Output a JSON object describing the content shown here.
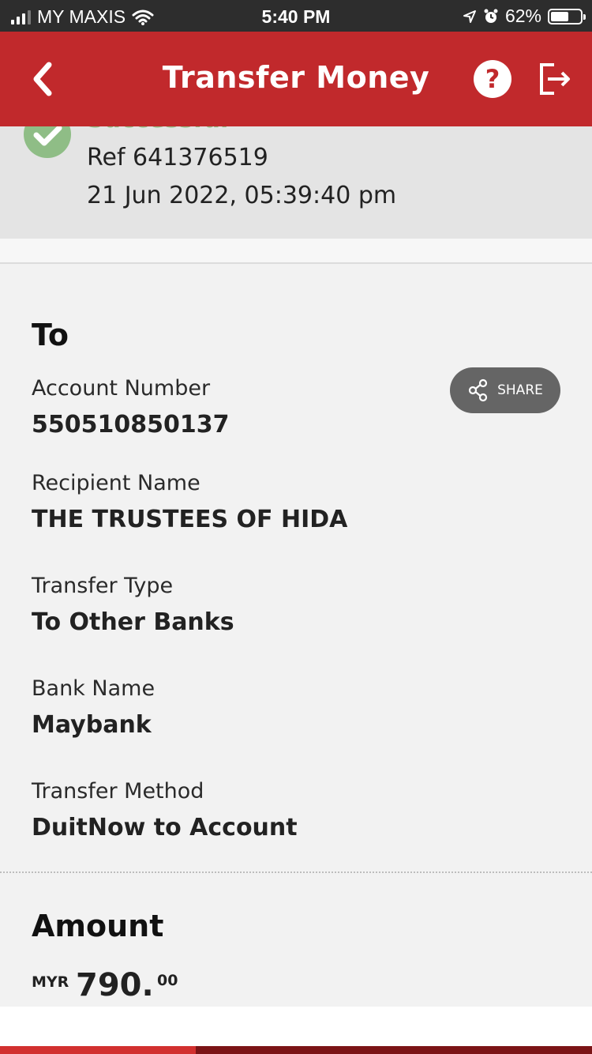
{
  "status_bar": {
    "carrier": "MY MAXIS",
    "time": "5:40 PM",
    "battery": "62%",
    "battery_level": 0.62
  },
  "header": {
    "title": "Transfer Money",
    "back_icon": "chevron-left-icon",
    "help_label": "?",
    "logout_icon": "logout-icon",
    "background": "#c1292c"
  },
  "status": {
    "label": "Successful",
    "ref": "Ref 641376519",
    "datetime": "21 Jun 2022, 05:39:40 pm",
    "color": "#8fbd86"
  },
  "to": {
    "heading": "To",
    "share_label": "SHARE",
    "fields": [
      {
        "label": "Account Number",
        "value": "550510850137"
      },
      {
        "label": "Recipient Name",
        "value": "THE TRUSTEES OF HIDA"
      },
      {
        "label": "Transfer Type",
        "value": "To Other Banks"
      },
      {
        "label": "Bank Name",
        "value": "Maybank"
      },
      {
        "label": "Transfer Method",
        "value": "DuitNow to Account"
      }
    ]
  },
  "amount": {
    "heading": "Amount",
    "currency": "MYR",
    "whole": "790.",
    "cents": "00"
  },
  "bottom_progress": 0.33
}
